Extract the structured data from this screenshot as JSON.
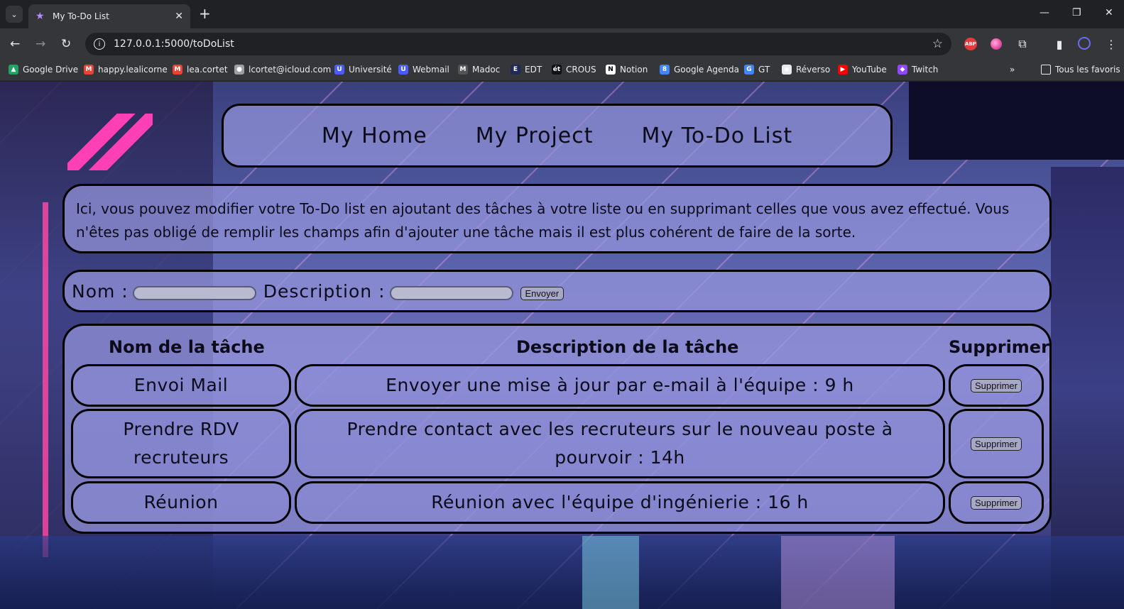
{
  "browser": {
    "tab_title": "My To-Do List",
    "url": "127.0.0.1:5000/toDoList",
    "bookmarks": [
      {
        "label": "Google Drive",
        "icon": "google-drive-icon",
        "color": "#1fa463"
      },
      {
        "label": "happy.lealicorne",
        "icon": "gmail-icon",
        "color": "#ea4335"
      },
      {
        "label": "lea.cortet",
        "icon": "gmail-icon",
        "color": "#ea4335"
      },
      {
        "label": "lcortet@icloud.com",
        "icon": "apple-icon",
        "color": "#9aa0a6"
      },
      {
        "label": "Université",
        "icon": "university-icon",
        "color": "#4a5cff"
      },
      {
        "label": "Webmail",
        "icon": "webmail-icon",
        "color": "#4a5cff"
      },
      {
        "label": "Madoc",
        "icon": "madoc-icon",
        "color": "#555"
      },
      {
        "label": "EDT",
        "icon": "edt-icon",
        "color": "#1f2a5a"
      },
      {
        "label": "CROUS",
        "icon": "crous-icon",
        "color": "#111"
      },
      {
        "label": "Notion",
        "icon": "notion-icon",
        "color": "#fff"
      },
      {
        "label": "Google Agenda",
        "icon": "google-agenda-icon",
        "color": "#4285f4"
      },
      {
        "label": "GT",
        "icon": "google-translate-icon",
        "color": "#4285f4"
      },
      {
        "label": "Réverso",
        "icon": "reverso-icon",
        "color": "#e8eaed"
      },
      {
        "label": "YouTube",
        "icon": "youtube-icon",
        "color": "#ff0000"
      },
      {
        "label": "Twitch",
        "icon": "twitch-icon",
        "color": "#9146ff"
      }
    ],
    "all_bookmarks": "Tous les favoris"
  },
  "nav": {
    "home": "My Home",
    "project": "My Project",
    "todo": "My To-Do List"
  },
  "intro": "Ici, vous pouvez modifier votre To-Do list en ajoutant des tâches à votre liste ou en supprimant celles que vous avez effectué. Vous n'êtes pas obligé de remplir les champs afin d'ajouter une tâche mais il est plus cohérent de faire de la sorte.",
  "form": {
    "name_label": "Nom :",
    "name_value": "",
    "description_label": "Description :",
    "description_value": "",
    "submit": "Envoyer"
  },
  "table": {
    "headers": {
      "name": "Nom de la tâche",
      "description": "Description de la tâche",
      "delete": "Supprimer"
    },
    "rows": [
      {
        "name": "Envoi Mail",
        "description": "Envoyer une mise à jour par e-mail à l'équipe : 9 h",
        "action": "Supprimer"
      },
      {
        "name": "Prendre RDV recruteurs",
        "description": "Prendre contact avec les recruteurs sur le nouveau poste à pourvoir : 14h",
        "action": "Supprimer"
      },
      {
        "name": "Réunion",
        "description": "Réunion avec l'équipe d'ingénierie : 16 h",
        "action": "Supprimer"
      }
    ]
  }
}
